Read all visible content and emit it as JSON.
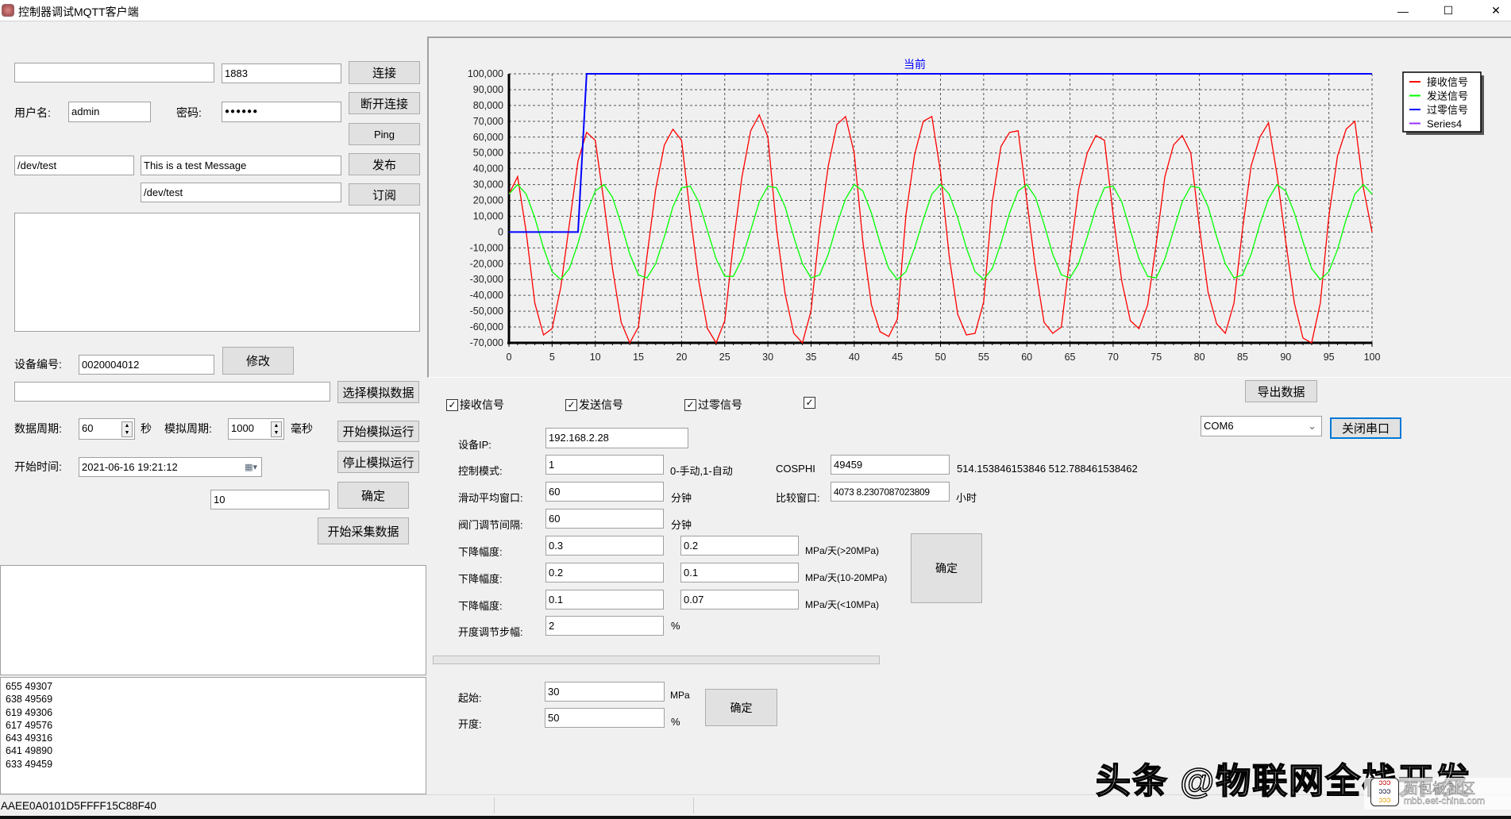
{
  "window": {
    "title": "控制器调试MQTT客户端",
    "minimize": "—",
    "maximize": "☐",
    "close": "✕"
  },
  "mqtt": {
    "host_value": "",
    "port_value": "1883",
    "connect_label": "连接",
    "disconnect_label": "断开连接",
    "ping_label": "Ping",
    "username_label": "用户名:",
    "username_value": "admin",
    "password_label": "密码:",
    "password_value": "●●●●●●",
    "publish_topic": "/dev/test",
    "publish_message": "This is a test Message",
    "publish_label": "发布",
    "subscribe_topic": "/dev/test",
    "subscribe_label": "订阅",
    "message_log": ""
  },
  "device": {
    "id_label": "设备编号:",
    "id_value": "0020004012",
    "modify_label": "修改",
    "sim_file_value": "",
    "select_sim_label": "选择模拟数据",
    "data_period_label": "数据周期:",
    "data_period_value": "60",
    "data_period_unit": "秒",
    "sim_period_label": "模拟周期:",
    "sim_period_value": "1000",
    "sim_period_unit": "毫秒",
    "start_sim_label": "开始模拟运行",
    "stop_sim_label": "停止模拟运行",
    "start_time_label": "开始时间:",
    "start_time_value": "2021-06-16 19:21:12",
    "count_value": "10",
    "confirm_label": "确定",
    "start_collect_label": "开始采集数据"
  },
  "log_lines": [
    "655 49307",
    "638 49569",
    "619 49306",
    "617 49576",
    "643 49316",
    "641 49890",
    "633 49459"
  ],
  "status_text": "AAEE0A0101D5FFFF15C88F40",
  "checkboxes": [
    {
      "label": "接收信号",
      "checked": true
    },
    {
      "label": "发送信号",
      "checked": true
    },
    {
      "label": "过零信号",
      "checked": true
    },
    {
      "label": "",
      "checked": true
    }
  ],
  "export_label": "导出数据",
  "serial": {
    "port": "COM6",
    "close_label": "关闭串口"
  },
  "params": {
    "ip_label": "设备IP:",
    "ip_value": "192.168.2.28",
    "mode_label": "控制模式:",
    "mode_value": "1",
    "mode_hint": "0-手动,1-自动",
    "cosphi_label": "COSPHI",
    "cosphi_value": "49459",
    "cosphi_readout": "514.153846153846 512.788461538462",
    "avg_label": "滑动平均窗口:",
    "avg_value": "60",
    "avg_unit": "分钟",
    "compare_label": "比较窗口:",
    "compare_value": "4073 8.2307087023809",
    "compare_unit": "小时",
    "valve_label": "阀门调节间隔:",
    "valve_value": "60",
    "valve_unit": "分钟",
    "drop_rows": [
      {
        "label": "下降幅度:",
        "a": "0.3",
        "b": "0.2",
        "unit": "MPa/天(>20MPa)"
      },
      {
        "label": "下降幅度:",
        "a": "0.2",
        "b": "0.1",
        "unit": "MPa/天(10-20MPa)"
      },
      {
        "label": "下降幅度:",
        "a": "0.1",
        "b": "0.07",
        "unit": "MPa/天(<10MPa)"
      }
    ],
    "step_label": "开度调节步幅:",
    "step_value": "2",
    "step_unit": "%",
    "confirm_label": "确定"
  },
  "progress": 0,
  "bottom": {
    "start_label": "起始:",
    "start_value": "30",
    "start_unit": "MPa",
    "open_label": "开度:",
    "open_value": "50",
    "open_unit": "%",
    "confirm_label": "确定"
  },
  "watermark": {
    "text": "头条 @物联网全栈开发",
    "logo_text": "面包板社区",
    "logo_url_text": "mbb.eet-china.com"
  },
  "chart_data": {
    "type": "line",
    "title": "当前",
    "xlim": [
      0,
      100
    ],
    "ylim": [
      -70000,
      100000
    ],
    "xticks": [
      0,
      5,
      10,
      15,
      20,
      25,
      30,
      35,
      40,
      45,
      50,
      55,
      60,
      65,
      70,
      75,
      80,
      85,
      90,
      95,
      100
    ],
    "yticks": [
      100000,
      90000,
      80000,
      70000,
      60000,
      50000,
      40000,
      30000,
      20000,
      10000,
      0,
      -10000,
      -20000,
      -30000,
      -40000,
      -50000,
      -60000,
      -70000
    ],
    "ytick_labels": [
      "100,000",
      "90,000",
      "80,000",
      "70,000",
      "60,000",
      "50,000",
      "40,000",
      "30,000",
      "20,000",
      "10,000",
      "0",
      "-10,000",
      "-20,000",
      "-30,000",
      "-40,000",
      "-50,000",
      "-60,000",
      "-70,000"
    ],
    "grid": true,
    "legend_position": "top-right",
    "series": [
      {
        "name": "接收信号",
        "color": "#ff0000",
        "x_start": 0,
        "x_step": 1,
        "values": [
          24000,
          35000,
          0,
          -45000,
          -65000,
          -61000,
          -35000,
          5000,
          45000,
          63000,
          58000,
          19000,
          -23000,
          -57000,
          -70000,
          -60000,
          -15000,
          27000,
          55000,
          65000,
          58000,
          11000,
          -31000,
          -61000,
          -70000,
          -56000,
          -7000,
          35000,
          64000,
          74000,
          60000,
          2000,
          -39000,
          -64000,
          -70000,
          -50000,
          2000,
          42000,
          68000,
          73000,
          50000,
          -6000,
          -46000,
          -63000,
          -66000,
          -55000,
          11000,
          49000,
          70000,
          73000,
          38000,
          -15000,
          -52000,
          -65000,
          -64000,
          -44000,
          19000,
          54000,
          63000,
          64000,
          20000,
          -23000,
          -57000,
          -64000,
          -60000,
          -15000,
          27000,
          50000,
          61000,
          58000,
          11000,
          -31000,
          -56000,
          -61000,
          -46000,
          -7000,
          35000,
          55000,
          61000,
          50000,
          3000,
          -38000,
          -58000,
          -64000,
          -45000,
          2000,
          42000,
          60000,
          69000,
          36000,
          -6000,
          -45000,
          -67000,
          -70000,
          -45000,
          10000,
          48000,
          65000,
          70000,
          28000,
          0
        ]
      },
      {
        "name": "发送信号",
        "color": "#00ff00",
        "x_start": 0,
        "x_step": 1,
        "values": [
          24000,
          30000,
          24000,
          9000,
          -10000,
          -25000,
          -30000,
          -23000,
          -7000,
          12000,
          26000,
          30000,
          22000,
          5000,
          -14000,
          -27000,
          -29000,
          -20000,
          -3000,
          16000,
          28000,
          29000,
          19000,
          1000,
          -17000,
          -28000,
          -28000,
          -17000,
          1000,
          19000,
          29000,
          28000,
          16000,
          -3000,
          -20000,
          -29000,
          -27000,
          -14000,
          5000,
          21000,
          30000,
          26000,
          12000,
          -7000,
          -23000,
          -30000,
          -25000,
          -10000,
          8000,
          24000,
          30000,
          24000,
          9000,
          -10000,
          -25000,
          -30000,
          -23000,
          -7000,
          12000,
          26000,
          30000,
          22000,
          5000,
          -14000,
          -27000,
          -29000,
          -20000,
          -3000,
          15000,
          28000,
          29000,
          19000,
          1000,
          -17000,
          -28000,
          -29000,
          -17000,
          1000,
          19000,
          29000,
          28000,
          16000,
          -3000,
          -20000,
          -29000,
          -27000,
          -14000,
          5000,
          21000,
          30000,
          26000,
          12000,
          -6000,
          -23000,
          -30000,
          -25000,
          -11000,
          8000,
          24000,
          30000,
          24000
        ]
      },
      {
        "name": "过零信号",
        "color": "#0000ff",
        "x": [
          0,
          8,
          9,
          100
        ],
        "values": [
          0,
          0,
          100000,
          100000
        ]
      },
      {
        "name": "Series4",
        "color": "#9b30ff",
        "values": []
      }
    ]
  }
}
